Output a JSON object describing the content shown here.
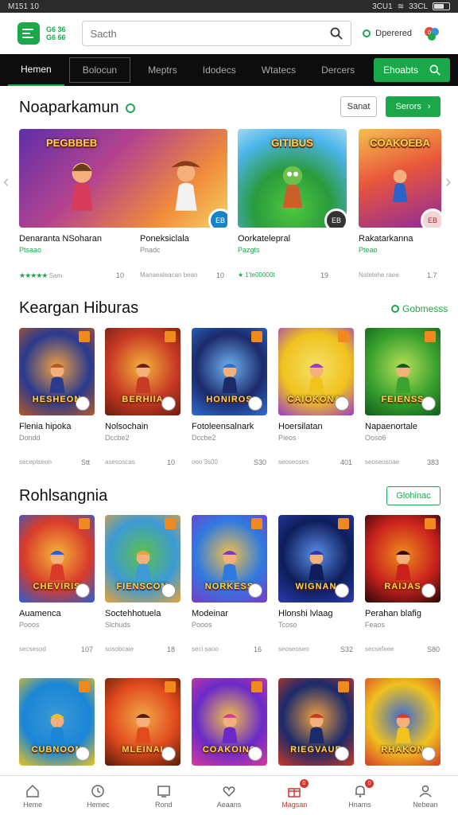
{
  "statusbar": {
    "time": "M151 10",
    "right_text": "3CU1",
    "pct": "33CL"
  },
  "header": {
    "logo_text_line1": "G6 36",
    "logo_text_line2": "G6 66",
    "search_placeholder": "Sacth",
    "account_label": "Dperered"
  },
  "nav": {
    "tabs": [
      "Hemen",
      "Bolocun",
      "Meptrs",
      "Idodecs",
      "Wtatecs",
      "Dercers"
    ],
    "cta_label": "Ehoabts"
  },
  "featured": {
    "title": "Noaparkamun",
    "btn_outline": "Sanat",
    "btn_green": "Serors",
    "items": [
      {
        "title": "Denaranta NSoharan",
        "sub": "Ptsaao",
        "meta": "Sam",
        "rating_text": "★★★★★",
        "num": "10",
        "badge": "EB"
      },
      {
        "title": "Poneksiclala",
        "sub": "Pnadc",
        "meta": "Manaealeacan bean",
        "num": "10",
        "badge": "EB"
      },
      {
        "title": "Oorkatelepral",
        "sub": "Pazgts",
        "meta": "★ 1'te00000t",
        "num": "19"
      },
      {
        "title": "Rakatarkanna",
        "sub": "Pteao",
        "meta": "Natetehe raee",
        "num": "1.7"
      }
    ]
  },
  "section2": {
    "title": "Keargan Hiburas",
    "link": "Gobmesss",
    "items": [
      {
        "title": "Flenia hipoka",
        "sub": "Dondd",
        "meta": "seceptseon",
        "num": "Stt",
        "art": "HESHEON"
      },
      {
        "title": "Nolsochain",
        "sub": "Dccbe2",
        "meta": "asesoscas",
        "num": "10",
        "art": "BERHIIA"
      },
      {
        "title": "Fotoleensalnark",
        "sub": "Dccbe2",
        "meta": "ooo 3s00",
        "num": "S30",
        "art": "HONIROS"
      },
      {
        "title": "Hoersilatan",
        "sub": "Pieos",
        "meta": "seoseoses",
        "num": "401",
        "art": "CAIOKONAI"
      },
      {
        "title": "Napaenortale",
        "sub": "Ooso6",
        "meta": "seoseosoae",
        "num": "383",
        "art": "FEIENSS"
      }
    ]
  },
  "section3": {
    "title": "Rohlsangnia",
    "btn": "Glohinac",
    "items": [
      {
        "title": "Auamenca",
        "sub": "Pooos",
        "meta": "secsesod",
        "num": "107",
        "art": "CHEVIRIS"
      },
      {
        "title": "Soctehhotuela",
        "sub": "Slchuds",
        "meta": "sosobcaie",
        "num": "18",
        "art": "FIENSCOM"
      },
      {
        "title": "Modeinar",
        "sub": "Pooos",
        "meta": "seci saoo",
        "num": "16",
        "art": "NORKESS"
      },
      {
        "title": "Hlonshi lvlaag",
        "sub": "Tcoso",
        "meta": "seoseoseo",
        "num": "S32",
        "art": "WIGNAN"
      },
      {
        "title": "Perahan blafig",
        "sub": "Feaos",
        "meta": "secsefeee",
        "num": "S80",
        "art": "RAIJAS"
      }
    ]
  },
  "section4": {
    "items": [
      {
        "art": "CUBNOON"
      },
      {
        "art": "MLEINAI"
      },
      {
        "art": "COAKOINS"
      },
      {
        "art": "RIEGVAUE"
      },
      {
        "art": "RHAKON"
      }
    ]
  },
  "bottomnav": [
    {
      "label": "Heme",
      "icon": "home-icon"
    },
    {
      "label": "Hemec",
      "icon": "clock-icon"
    },
    {
      "label": "Rond",
      "icon": "tv-icon"
    },
    {
      "label": "Aeaans",
      "icon": "heart-icon"
    },
    {
      "label": "Magsan",
      "icon": "gift-icon",
      "active": true,
      "badge": "0"
    },
    {
      "label": "Hnams",
      "icon": "bell-icon",
      "badge": "0"
    },
    {
      "label": "Nebean",
      "icon": "user-icon"
    }
  ],
  "colors": {
    "accent": "#1aa84a",
    "nav_bg": "#0d0d0d",
    "active": "#d6342e"
  }
}
